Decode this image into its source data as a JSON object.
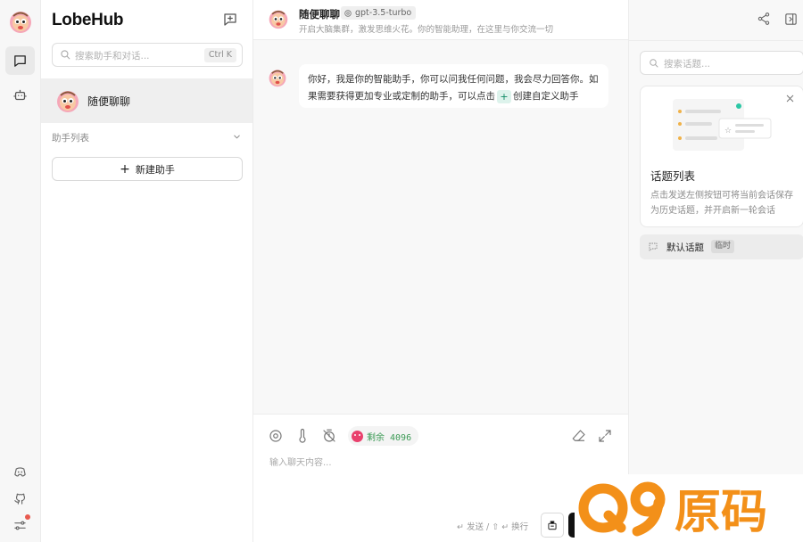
{
  "app": {
    "brand": "LobeHub"
  },
  "sidebar": {
    "search_placeholder": "搜索助手和对话...",
    "search_shortcut": "Ctrl K",
    "sessions": [
      {
        "name": "随便聊聊"
      }
    ],
    "group_title": "助手列表",
    "add_assistant_label": "新建助手"
  },
  "chat": {
    "title": "随便聊聊",
    "model": "gpt-3.5-turbo",
    "description": "开启大脑集群，激发思维火花。你的智能助理，在这里与你交流一切",
    "message_part1": "你好，我是你的智能助手，你可以问我任何问题，我会尽力回答你。如果需要获得更加专业或定制的助手，可以点击",
    "message_plus": "+",
    "message_part2": "创建自定义助手",
    "token_label": "剩余 4096",
    "input_placeholder": "输入聊天内容...",
    "send_hint": "↵ 发送 / ⇧ ↵ 换行"
  },
  "topics": {
    "search_placeholder": "搜索话题...",
    "guide_title": "话题列表",
    "guide_desc": "点击发送左侧按钮可将当前会话保存为历史话题，并开启新一轮会话",
    "default_topic": "默认话题",
    "default_topic_tag": "临时"
  },
  "watermark": {
    "text": "Q9原码"
  },
  "colors": {
    "accent_green": "#3b9a55",
    "watermark_orange": "#f39019",
    "notify_red": "#e85a4f"
  }
}
